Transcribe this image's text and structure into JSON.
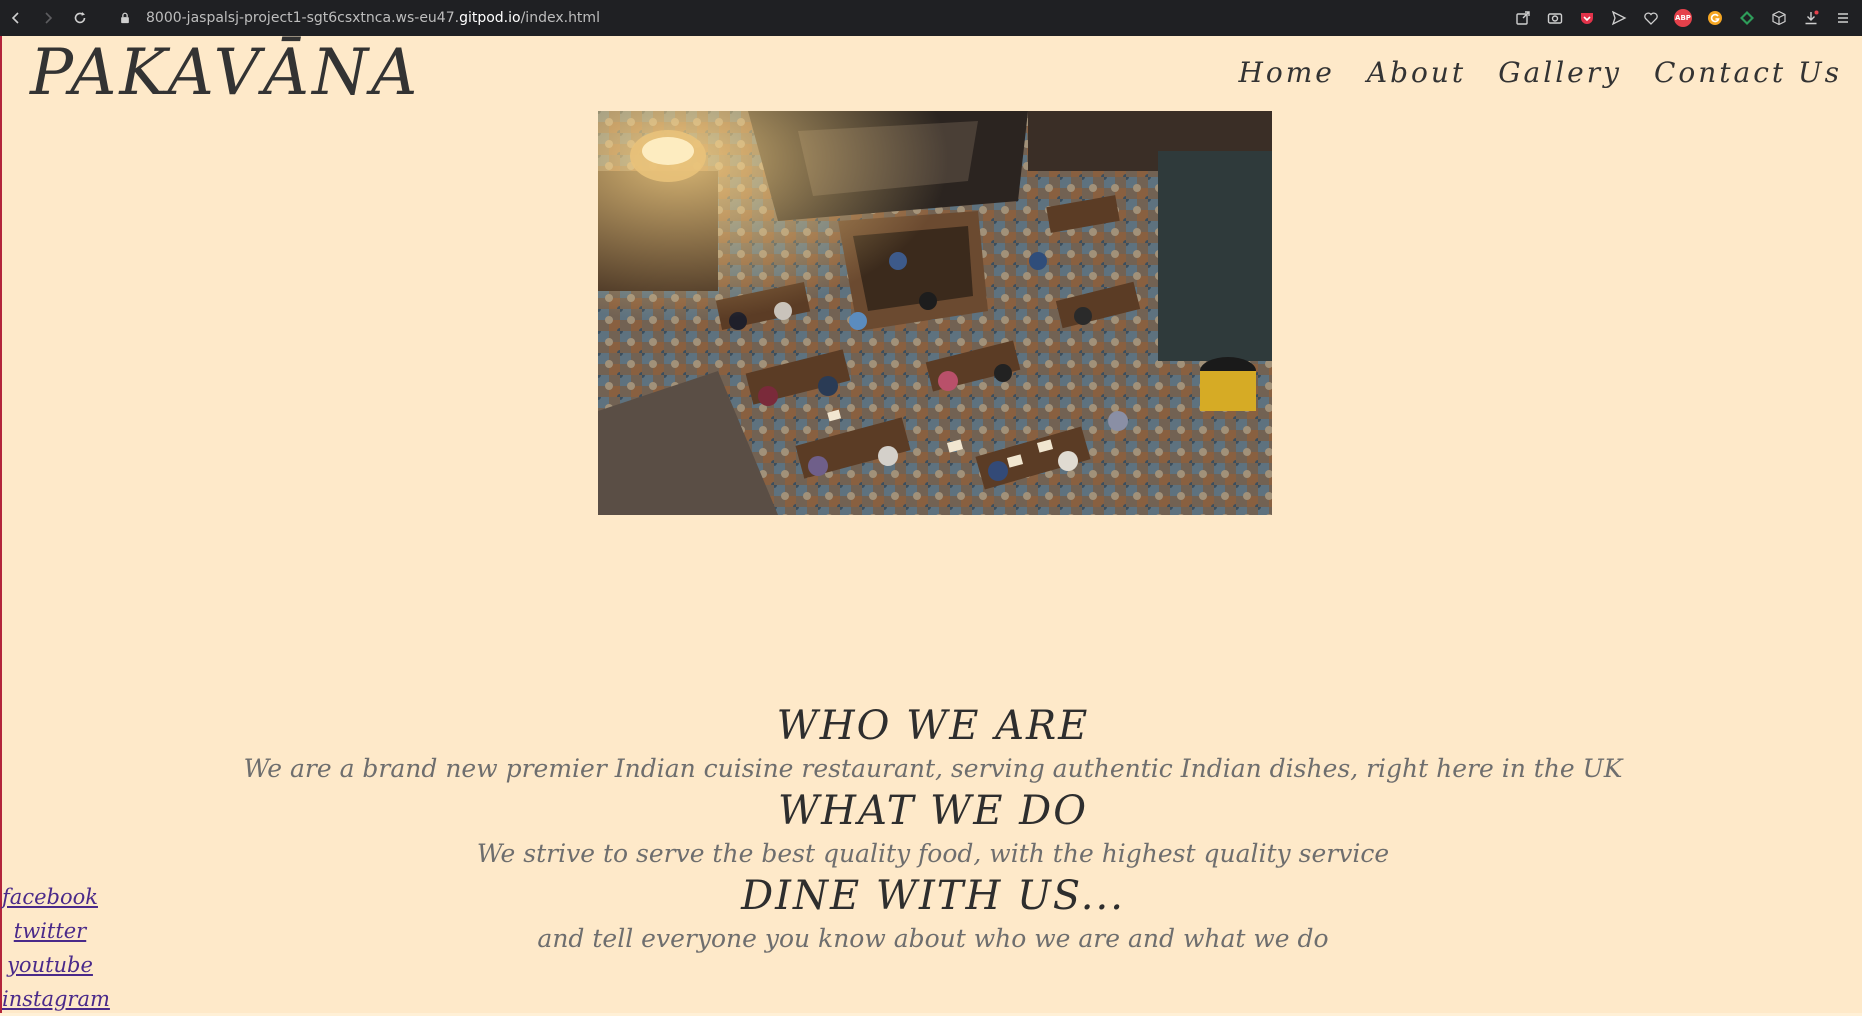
{
  "browser": {
    "url_prefix": "8000-jaspalsj-project1-sgt6csxtnca.ws-eu47.",
    "url_host": "gitpod.io",
    "url_path": "/index.html",
    "extension_badge": "ABP"
  },
  "site": {
    "logo": "PAKAVĀNA",
    "nav": [
      "Home",
      "About",
      "Gallery",
      "Contact Us"
    ]
  },
  "sections": [
    {
      "heading": "WHO WE ARE",
      "text": "We are a brand new premier Indian cuisine restaurant, serving authentic Indian dishes, right here in the UK"
    },
    {
      "heading": "WHAT WE DO",
      "text": "We strive to serve the best quality food, with the highest quality service"
    },
    {
      "heading": "DINE WITH US...",
      "text": "and tell everyone you know about who we are and what we do"
    }
  ],
  "social": [
    "facebook",
    "twitter",
    "youtube",
    "instagram"
  ],
  "colors": {
    "page_bg": "#fee9c9",
    "text_dark": "#333333",
    "text_muted": "#6e6e6e",
    "link": "#4a2a8a"
  }
}
